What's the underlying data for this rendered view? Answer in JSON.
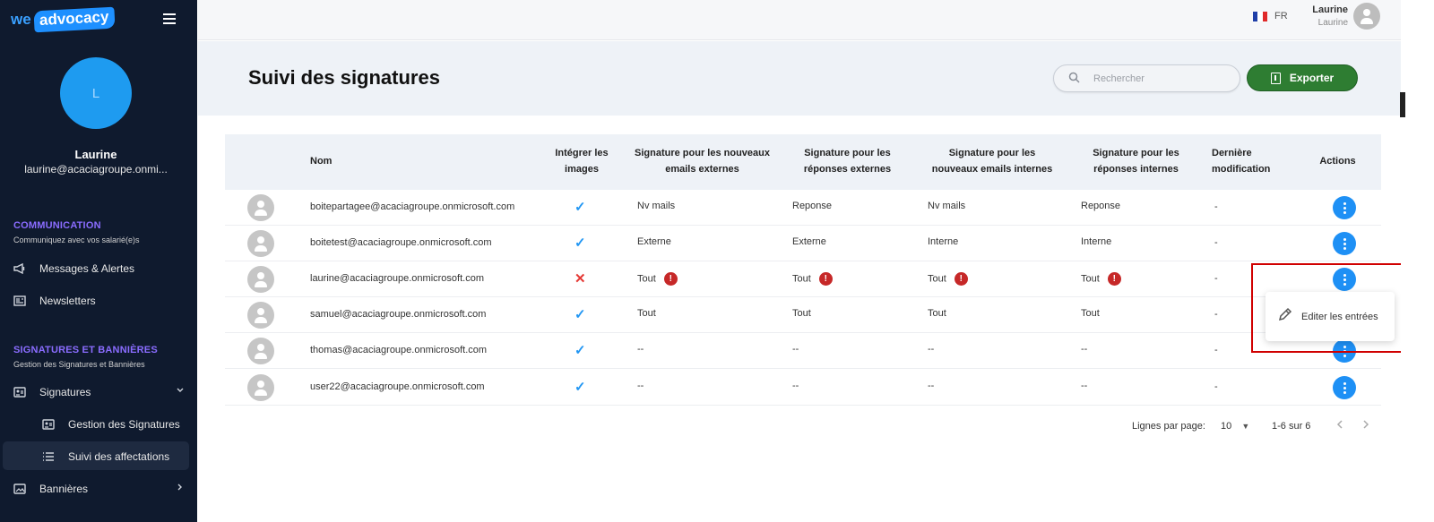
{
  "brand": {
    "we": "we",
    "advocacy": "advocacy"
  },
  "sidebar": {
    "avatar_initial": "L",
    "user_name": "Laurine",
    "user_email": "laurine@acaciagroupe.onmi...",
    "sections": [
      {
        "title": "COMMUNICATION",
        "subtitle": "Communiquez avec vos salarié(e)s"
      },
      {
        "title": "SIGNATURES ET BANNIÈRES",
        "subtitle": "Gestion des Signatures et Bannières"
      }
    ],
    "items": {
      "messages": "Messages & Alertes",
      "newsletters": "Newsletters",
      "signatures": "Signatures",
      "gestion": "Gestion des Signatures",
      "suivi": "Suivi des affectations",
      "bannieres": "Bannières"
    }
  },
  "header": {
    "lang": "FR",
    "user_name": "Laurine",
    "user_sub": "Laurine"
  },
  "page": {
    "title": "Suivi des signatures",
    "search_placeholder": "Rechercher",
    "export_label": "Exporter"
  },
  "table": {
    "headers": {
      "nom": "Nom",
      "images": "Intégrer les images",
      "new_ext": "Signature pour les nouveaux emails externes",
      "rep_ext": "Signature pour les réponses externes",
      "new_int": "Signature pour les nouveaux emails internes",
      "rep_int": "Signature pour les réponses internes",
      "modif": "Dernière modification",
      "actions": "Actions"
    },
    "rows": [
      {
        "email": "boitepartagee@acaciagroupe.onmicrosoft.com",
        "images": "check",
        "new_ext": "Nv mails",
        "rep_ext": "Reponse",
        "new_int": "Nv mails",
        "rep_int": "Reponse",
        "modif": "-"
      },
      {
        "email": "boitetest@acaciagroupe.onmicrosoft.com",
        "images": "check",
        "new_ext": "Externe",
        "rep_ext": "Externe",
        "new_int": "Interne",
        "rep_int": "Interne",
        "modif": "-"
      },
      {
        "email": "laurine@acaciagroupe.onmicrosoft.com",
        "images": "cross",
        "new_ext": "Tout",
        "rep_ext": "Tout",
        "new_int": "Tout",
        "rep_int": "Tout",
        "modif": "-",
        "warn": true
      },
      {
        "email": "samuel@acaciagroupe.onmicrosoft.com",
        "images": "check",
        "new_ext": "Tout",
        "rep_ext": "Tout",
        "new_int": "Tout",
        "rep_int": "Tout",
        "modif": "-"
      },
      {
        "email": "thomas@acaciagroupe.onmicrosoft.com",
        "images": "check",
        "new_ext": "--",
        "rep_ext": "--",
        "new_int": "--",
        "rep_int": "--",
        "modif": "-"
      },
      {
        "email": "user22@acaciagroupe.onmicrosoft.com",
        "images": "check",
        "new_ext": "--",
        "rep_ext": "--",
        "new_int": "--",
        "rep_int": "--",
        "modif": "-"
      }
    ],
    "warn_glyph": "!",
    "check_glyph": "✓",
    "cross_glyph": "✕"
  },
  "context_menu": {
    "edit_label": "Editer les entrées"
  },
  "pagination": {
    "rows_per_page_label": "Lignes par page:",
    "rows_per_page_value": "10",
    "range": "1-6 sur 6"
  },
  "colors": {
    "accent": "#1e90f5",
    "export": "#2e7d32",
    "sidebar": "#0f1a2e",
    "section": "#8a6cff",
    "warn": "#c62828"
  }
}
